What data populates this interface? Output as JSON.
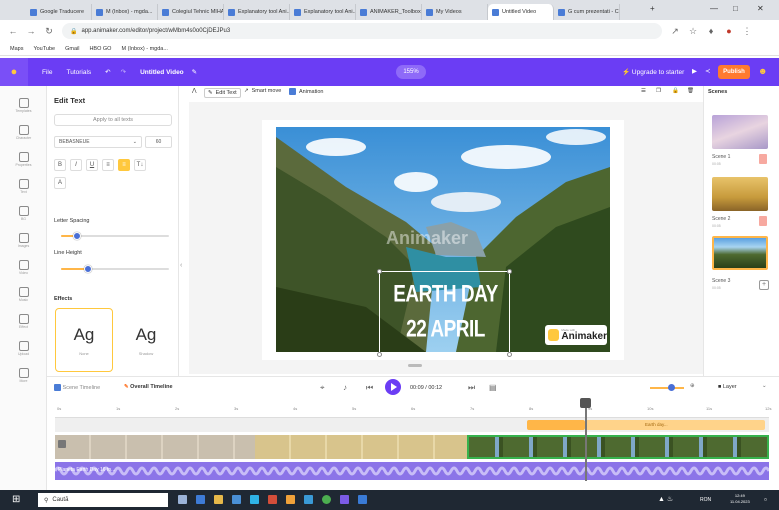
{
  "browser": {
    "tabs": [
      {
        "label": "Google Traducere"
      },
      {
        "label": "M (Inbox) - mgda..."
      },
      {
        "label": "Colegiul Tehnic MIHAI"
      },
      {
        "label": "Explanatory tool Ani..."
      },
      {
        "label": "Explanatory tool Ani..."
      },
      {
        "label": "ANIMAKER_Toolbox"
      },
      {
        "label": "My Videos"
      },
      {
        "label": "Untitled Video"
      },
      {
        "label": "G cum prezentati - Cu..."
      }
    ],
    "active_tab_index": 7,
    "url": "app.animaker.com/editor/project/wMbm4s0o0CjDEJPu3",
    "bookmarks": [
      "Maps",
      "YouTube",
      "Gmail",
      "HBO GO",
      "M (Inbox) - mgda..."
    ]
  },
  "app": {
    "menu": [
      "File",
      "Tutorials"
    ],
    "title": "Untitled Video",
    "zoom": "155%",
    "upgrade": "⚡ Upgrade to starter",
    "publish": "Publish",
    "brand_color": "#6b3df4",
    "accent_color": "#ff7a2f"
  },
  "rail": {
    "items": [
      "Templates",
      "Character",
      "Properties",
      "Text",
      "BG",
      "Images",
      "Video",
      "Music",
      "Effect",
      "Upload",
      "More"
    ]
  },
  "edit_panel": {
    "title": "Edit Text",
    "apply_all": "Apply to all texts",
    "font": "BEBASNEUE",
    "size": "60",
    "format_buttons": [
      "B",
      "I",
      "U",
      "≡",
      "≡",
      "T↓"
    ],
    "letter_spacing_label": "Letter Spacing",
    "letter_spacing_value": 0.15,
    "line_height_label": "Line Height",
    "line_height_value": 0.25,
    "effects_label": "Effects",
    "effects": [
      {
        "glyph": "Ag",
        "name": "None"
      },
      {
        "glyph": "Ag",
        "name": "Shadow"
      }
    ]
  },
  "canvas_toolbar": {
    "edit_text": "Edit Text",
    "smart_move": "Smart move",
    "animation": "Animation"
  },
  "canvas": {
    "title_line1": "EARTH DAY",
    "title_line2": "22 APRIL",
    "watermark": "Animaker",
    "badge_small": "Made with",
    "badge_name": "Animaker"
  },
  "scenes": {
    "header": "Scenes",
    "items": [
      {
        "label": "Scene 1",
        "duration": "00:05"
      },
      {
        "label": "Scene 2",
        "duration": "00:05"
      },
      {
        "label": "Scene 3",
        "duration": "00:05"
      }
    ]
  },
  "timeline": {
    "scene_timeline": "Scene Timeline",
    "overall_timeline": "Overall Timeline",
    "time": "00:09 / 00:12",
    "layer": "Layer",
    "ticks": [
      "0s",
      "1s",
      "2s",
      "3s",
      "4s",
      "5s",
      "6s",
      "7s",
      "8s",
      "9s",
      "10s",
      "11s",
      "12s"
    ],
    "text_track": "Earth day...",
    "audio_label": "Planeta Earth Day 16 to..."
  },
  "taskbar": {
    "search": "Caută",
    "time": "12:49",
    "date": "11.04.2023",
    "lang": "RON"
  }
}
